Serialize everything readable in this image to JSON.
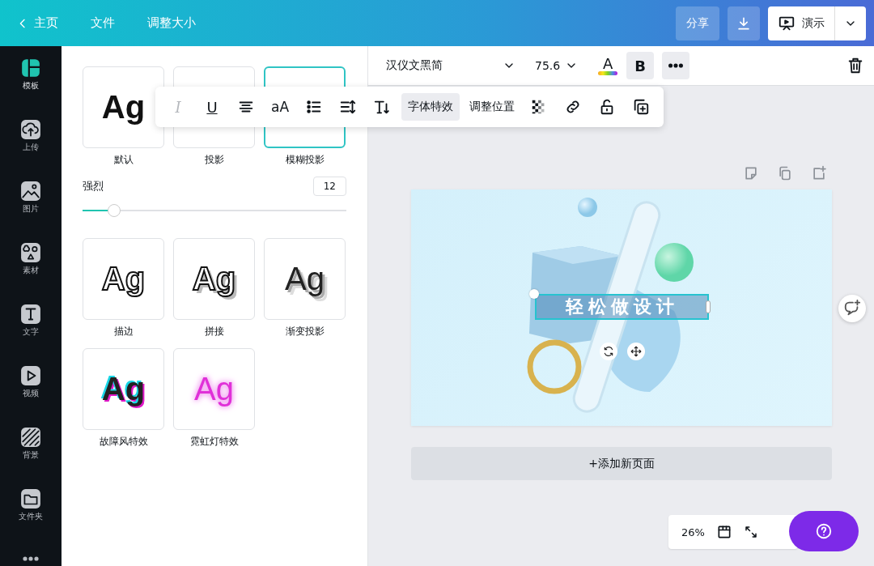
{
  "top_bar": {
    "back_label": "主页",
    "menu": [
      "文件",
      "调整大小"
    ],
    "share": "分享",
    "present": "演示"
  },
  "sidebar": {
    "items": [
      {
        "kind": "templates",
        "label": "模板",
        "selected": true
      },
      {
        "kind": "upload",
        "label": "上传",
        "selected": false
      },
      {
        "kind": "photos",
        "label": "图片",
        "selected": false
      },
      {
        "kind": "elements",
        "label": "素材",
        "selected": false
      },
      {
        "kind": "text",
        "label": "文字",
        "selected": false
      },
      {
        "kind": "video",
        "label": "视频",
        "selected": false
      },
      {
        "kind": "background",
        "label": "背景",
        "selected": false
      },
      {
        "kind": "folder",
        "label": "文件夹",
        "selected": false
      }
    ]
  },
  "effects_panel": {
    "effects": [
      {
        "kind": "none",
        "sample": "Ag",
        "label": "默认",
        "selected": false
      },
      {
        "kind": "shadow",
        "label": "投影",
        "selected": false
      },
      {
        "kind": "blur",
        "label": "模糊投影",
        "selected": true
      }
    ],
    "slider": {
      "label": "强烈",
      "value": "12",
      "level": 0.12
    },
    "more_effects": [
      {
        "kind": "outline",
        "sample": "Ag",
        "label": "描边",
        "selected": false
      },
      {
        "kind": "splice",
        "sample": "Ag",
        "label": "拼接",
        "selected": false
      },
      {
        "kind": "echo",
        "sample": "Ag",
        "label": "渐变投影",
        "selected": false
      },
      {
        "kind": "glitch",
        "sample": "Ag",
        "label": "故障风特效",
        "selected": false
      },
      {
        "kind": "neon",
        "sample": "Ag",
        "label": "霓虹灯特效",
        "selected": false
      }
    ]
  },
  "toolbar": {
    "font": "汉仪文黑简",
    "size": "75.6",
    "color_label": "A",
    "bold": {
      "label": "B",
      "on": true
    }
  },
  "text_toolbar": [
    {
      "kind": "italic",
      "label": "I",
      "disabled": true,
      "selected": false
    },
    {
      "kind": "underline",
      "label": "U",
      "disabled": false,
      "selected": false
    },
    {
      "kind": "align",
      "disabled": false,
      "selected": false
    },
    {
      "kind": "case",
      "label": "aA",
      "disabled": false,
      "selected": false
    },
    {
      "kind": "list",
      "disabled": false,
      "selected": false
    },
    {
      "kind": "spacing",
      "disabled": false,
      "selected": false
    },
    {
      "kind": "vertical",
      "disabled": false,
      "selected": false
    },
    {
      "kind": "effects",
      "label": "字体特效",
      "disabled": false,
      "selected": true
    },
    {
      "kind": "position",
      "label": "调整位置",
      "disabled": false,
      "selected": false
    },
    {
      "kind": "transparency",
      "disabled": false,
      "selected": false
    },
    {
      "kind": "link",
      "disabled": false,
      "selected": false
    },
    {
      "kind": "lock",
      "disabled": false,
      "selected": false
    },
    {
      "kind": "duplicate",
      "disabled": false,
      "selected": false
    }
  ],
  "canvas": {
    "design_text": "轻松做设计"
  },
  "add_page": "+添加新页面",
  "zoom": {
    "value": "26%"
  }
}
